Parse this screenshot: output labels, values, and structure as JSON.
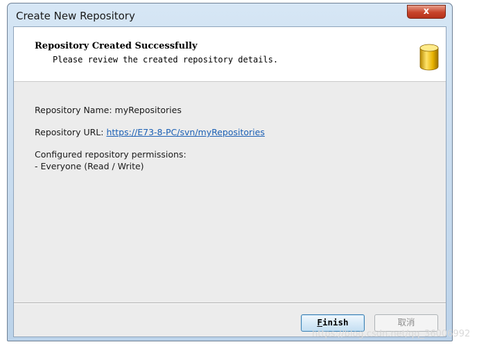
{
  "window": {
    "title": "Create New Repository",
    "close_label": "x"
  },
  "header": {
    "title": "Repository Created Successfully",
    "subtitle": "Please review the created repository details.",
    "icon": "database-icon"
  },
  "details": {
    "name_label": "Repository Name:",
    "name_value": "myRepositories",
    "url_label": "Repository URL:",
    "url_value": "https://E73-8-PC/svn/myRepositories",
    "permissions_label": "Configured repository permissions:",
    "permissions_value": "- Everyone (Read / Write)"
  },
  "buttons": {
    "finish_access_key": "F",
    "finish_rest": "inish",
    "cancel_label": "取消"
  },
  "watermark": "https://blog.csdn.net/qq_36006992",
  "colors": {
    "accent": "#1a5fb4",
    "close": "#c7432a"
  }
}
